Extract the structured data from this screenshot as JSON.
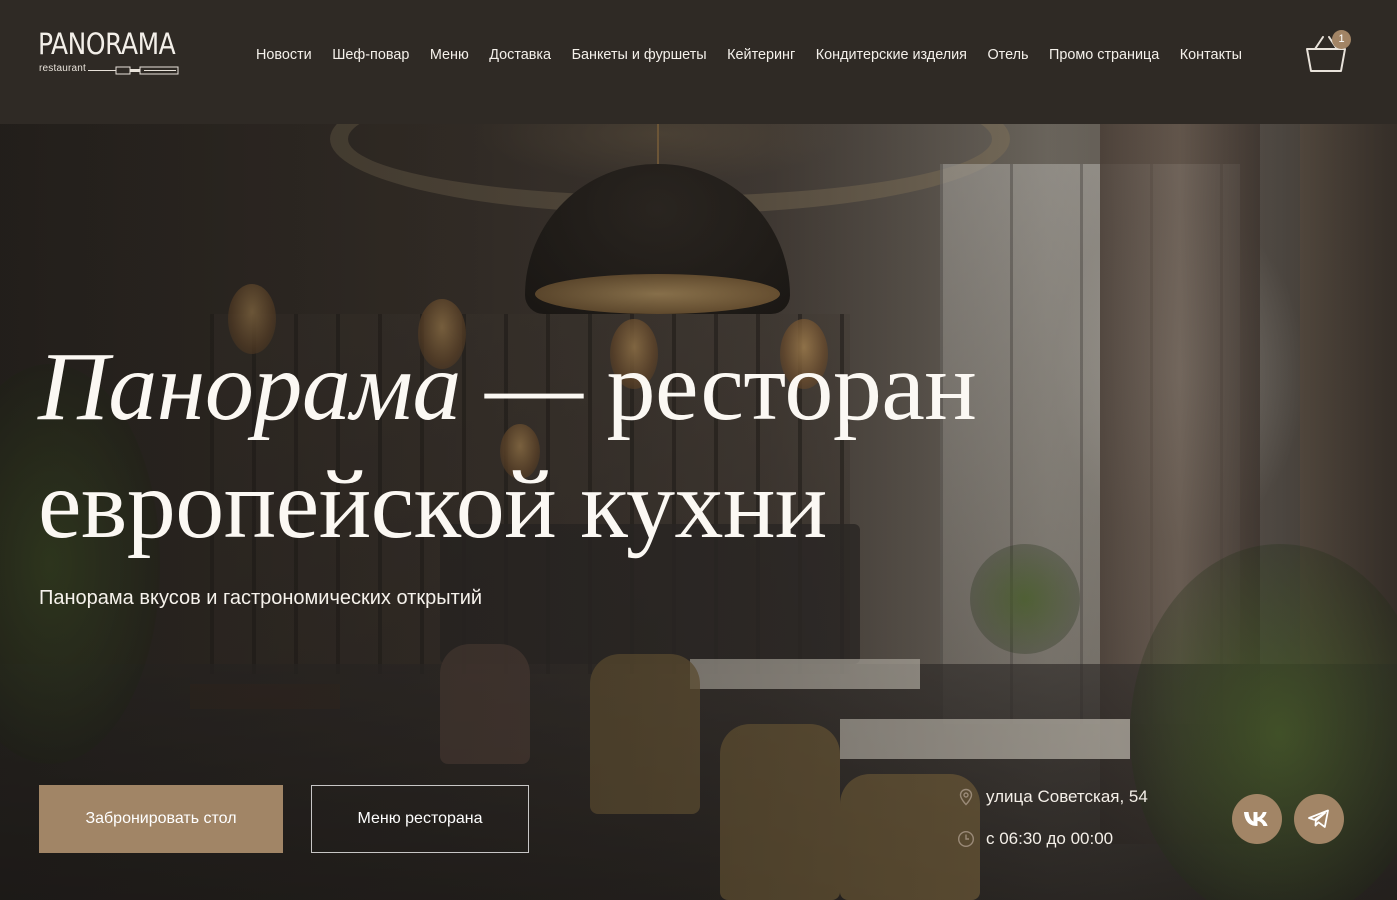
{
  "brand": {
    "name": "PANORAMA",
    "tagline": "restaurant"
  },
  "nav": {
    "items": [
      "Новости",
      "Шеф-повар",
      "Меню",
      "Доставка",
      "Банкеты и фуршеты",
      "Кейтеринг",
      "Кондитерские изделия",
      "Отель",
      "Промо страница",
      "Контакты"
    ]
  },
  "cart": {
    "icon": "basket-icon",
    "count": "1"
  },
  "hero": {
    "title_italic": "Панорама",
    "title_rest_line1": " — ресторан",
    "title_line2": "европейской кухни",
    "subtitle": "Панорама вкусов и гастрономических открытий",
    "book_button": "Забронировать стол",
    "menu_button": "Меню ресторана",
    "address": "улица Советская, 54",
    "hours": "с 06:30 до 00:00",
    "address_icon": "location-pin-icon",
    "hours_icon": "clock-icon"
  },
  "social": {
    "vk_icon": "vk-icon",
    "telegram_icon": "telegram-icon"
  },
  "colors": {
    "header_bg": "#2f2a25",
    "accent": "#a18566",
    "text": "#ffffff"
  }
}
